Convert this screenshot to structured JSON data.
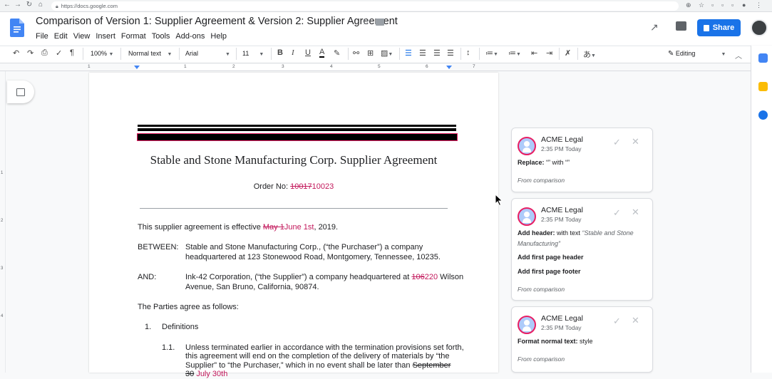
{
  "browser": {
    "url": "https://docs.google.com"
  },
  "doc": {
    "title": "Comparison of Version 1: Supplier Agreement & Version 2: Supplier Agreement",
    "menu": [
      "File",
      "Edit",
      "View",
      "Insert",
      "Format",
      "Tools",
      "Add-ons",
      "Help"
    ],
    "share_label": "Share"
  },
  "toolbar": {
    "zoom": "100%",
    "style": "Normal text",
    "font": "Arial",
    "size": "11",
    "mode": "Editing"
  },
  "ruler": {
    "numbers": [
      "1",
      "1",
      "2",
      "3",
      "4",
      "5",
      "6",
      "7"
    ]
  },
  "vruler": {
    "numbers": [
      "1",
      "2",
      "3",
      "4"
    ]
  },
  "body": {
    "title": "Stable and Stone Manufacturing Corp. Supplier Agreement",
    "order_label": "Order No: ",
    "order_old": "10017",
    "order_new": "10023",
    "effective_pre": "This supplier agreement is effective ",
    "effective_old": "May 1",
    "effective_new": "June 1st",
    "effective_post": ", 2019.",
    "between_label": "BETWEEN:",
    "between_text1": "Stable and Stone Manufacturing Corp., (“the Purchaser”) a company",
    "between_text2": "headquartered at 123 Stonewood Road, Montgomery, Tennessee, 10235.",
    "and_label": "AND:",
    "and_text1_pre": "Ink-42 Corporation, (“the Supplier”) a company headquartered at ",
    "and_old": "106",
    "and_new": "220",
    "and_text1_post": " Wilson",
    "and_text2": "Avenue, San Bruno, California, 90874.",
    "parties": "The Parties agree as follows:",
    "item1_num": "1.",
    "item1_label": "Definitions",
    "item11_num": "1.1.",
    "item11_line1": "Unless terminated earlier in accordance with the termination provisions set forth,",
    "item11_line2": "this agreement will end on the completion of the delivery of materials by “the",
    "item11_line3_pre": "Supplier” to “the Purchaser,” which in no event shall be later than ",
    "item11_line3_old": "September",
    "item11_line4_old": "30",
    "item11_line4_new": "July 30th"
  },
  "comments": [
    {
      "author": "ACME Legal",
      "time": "2:35 PM Today",
      "lines": [
        {
          "bold": "Replace:",
          "text": " “” with “”"
        }
      ],
      "from": "From comparison"
    },
    {
      "author": "ACME Legal",
      "time": "2:35 PM Today",
      "lines": [
        {
          "bold": "Add header:",
          "text": " with text ",
          "italic": "“Stable and Stone Manufacturing”"
        },
        {
          "bold": "Add first page header"
        },
        {
          "bold": "Add first page footer"
        }
      ],
      "from": "From comparison"
    },
    {
      "author": "ACME Legal",
      "time": "2:35 PM Today",
      "lines": [
        {
          "bold": "Format normal text:",
          "text": " style"
        }
      ],
      "from": "From comparison"
    }
  ],
  "colors": {
    "accent": "#1a73e8",
    "insert": "#c2185b"
  }
}
